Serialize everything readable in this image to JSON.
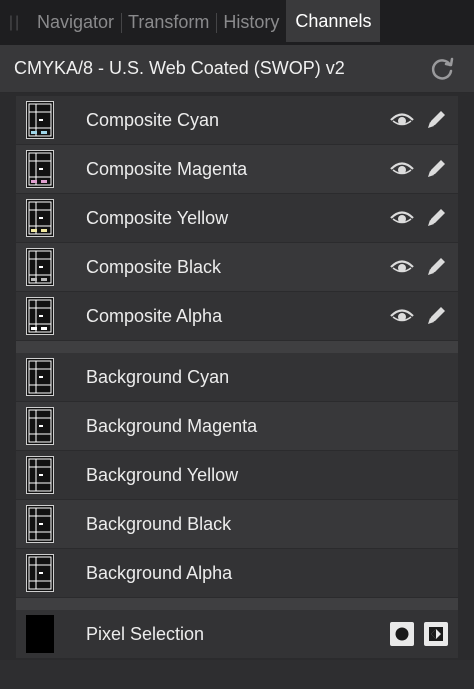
{
  "tabs": [
    {
      "label": "Navigator",
      "active": false
    },
    {
      "label": "Transform",
      "active": false
    },
    {
      "label": "History",
      "active": false
    },
    {
      "label": "Channels",
      "active": true
    }
  ],
  "header": {
    "title": "CMYKA/8 - U.S. Web Coated (SWOP) v2",
    "reset_icon": "reset-icon"
  },
  "composite_channels": [
    {
      "label": "Composite Cyan",
      "icons": [
        "eye-icon",
        "pencil-icon"
      ]
    },
    {
      "label": "Composite Magenta",
      "icons": [
        "eye-icon",
        "pencil-icon"
      ]
    },
    {
      "label": "Composite Yellow",
      "icons": [
        "eye-icon",
        "pencil-icon"
      ]
    },
    {
      "label": "Composite Black",
      "icons": [
        "eye-icon",
        "pencil-icon"
      ]
    },
    {
      "label": "Composite Alpha",
      "icons": [
        "eye-icon",
        "pencil-icon"
      ]
    }
  ],
  "background_channels": [
    {
      "label": "Background Cyan"
    },
    {
      "label": "Background Magenta"
    },
    {
      "label": "Background Yellow"
    },
    {
      "label": "Background Black"
    },
    {
      "label": "Background Alpha"
    }
  ],
  "pixel_selection": {
    "label": "Pixel Selection",
    "icons": [
      "selection-circle-icon",
      "selection-invert-icon"
    ]
  }
}
